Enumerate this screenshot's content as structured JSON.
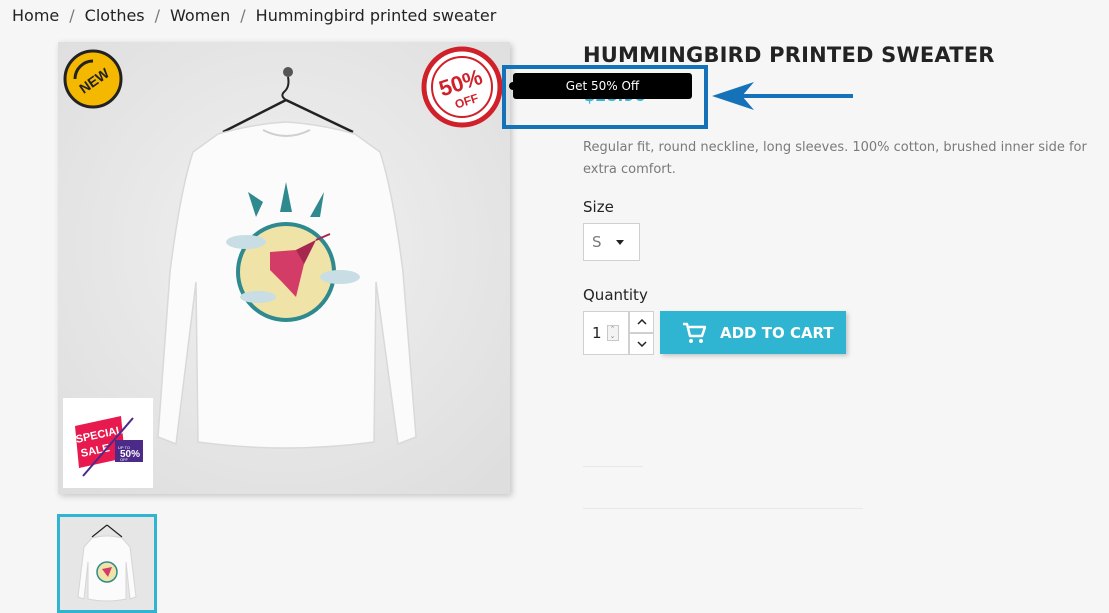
{
  "breadcrumb": {
    "items": [
      "Home",
      "Clothes",
      "Women",
      "Hummingbird printed sweater"
    ],
    "separator": "/"
  },
  "product": {
    "title": "HUMMINGBIRD PRINTED SWEATER",
    "price": "$28.90",
    "description": "Regular fit, round neckline, long sleeves. 100% cotton, brushed inner side for extra comfort.",
    "size_label": "Size",
    "size_selected": "S",
    "quantity_label": "Quantity",
    "quantity_value": "1",
    "add_to_cart_label": "ADD TO CART"
  },
  "badges": {
    "new_sticker": "NEW",
    "discount_stamp_percent": "50%",
    "discount_stamp_off": "OFF",
    "special_sale_line1": "SPECIAL",
    "special_sale_line2": "SALE",
    "special_sale_upto": "UP TO",
    "special_sale_percent": "50%",
    "special_sale_off": "OFF"
  },
  "tooltip": {
    "text": "Get 50% Off"
  },
  "colors": {
    "accent": "#2fb5d2",
    "annotation": "#1672b8",
    "stamp_red": "#d0202a",
    "sticker_yellow": "#f5b800"
  },
  "icons": {
    "cart": "shopping-cart-icon",
    "caret": "chevron-down-icon",
    "arrow": "arrow-left-icon"
  }
}
